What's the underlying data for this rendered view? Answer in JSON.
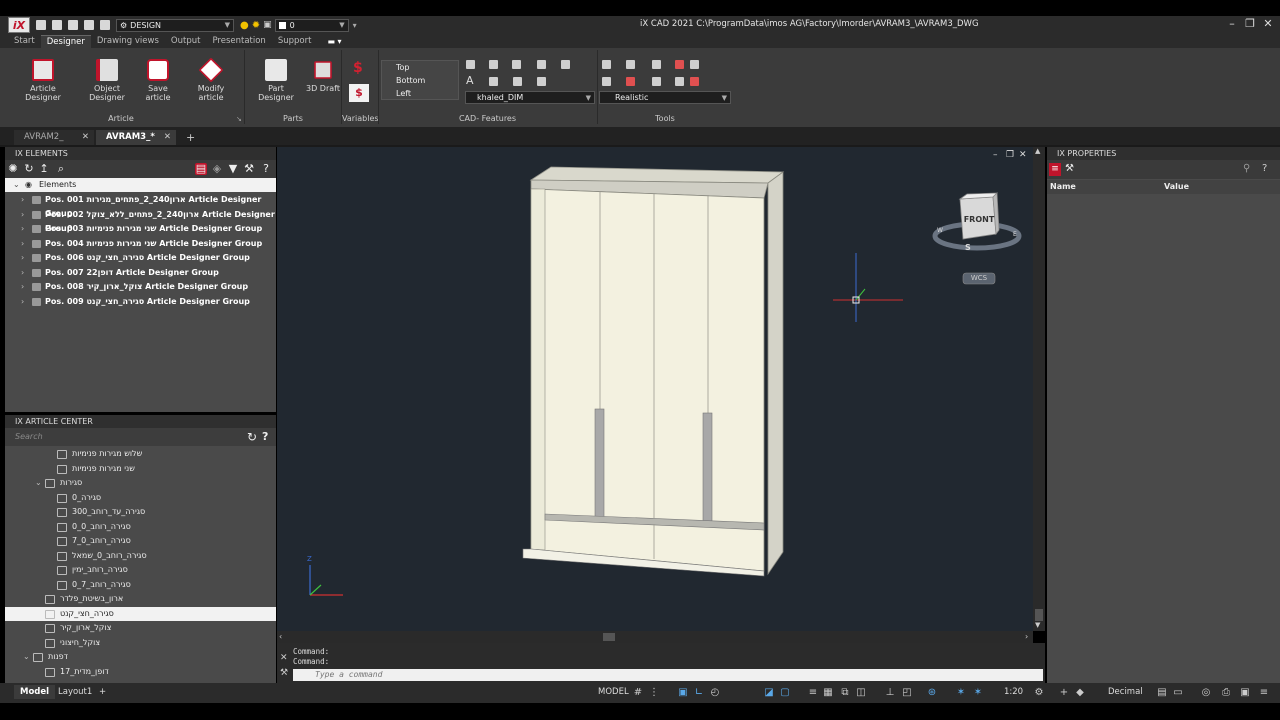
{
  "app": {
    "logo": "iX",
    "workspace": "DESIGN",
    "layer": "0",
    "title": "iX CAD 2021    C:\\ProgramData\\imos AG\\Factory\\Imorder\\AVRAM3_\\AVRAM3_DWG"
  },
  "menu": [
    "Start",
    "Designer",
    "Drawing views",
    "Output",
    "Presentation",
    "Support"
  ],
  "ribbon": {
    "article_designer": "Article Designer",
    "object_designer": "Object Designer",
    "save_article": "Save article",
    "modify_article": "Modify article",
    "group_article": "Article",
    "part_designer": "Part Designer",
    "draft_3d": "3D Draft",
    "group_parts": "Parts",
    "group_variables": "Variables",
    "views": [
      "Top",
      "Bottom",
      "Left"
    ],
    "dim_style": "khaled_DIM",
    "group_cad": "CAD- Features",
    "visual_style": "Realistic",
    "group_tools": "Tools"
  },
  "doc_tabs": [
    "AVRAM2_",
    "AVRAM3_*"
  ],
  "elements": {
    "header": "IX ELEMENTS",
    "root": "Elements",
    "items": [
      "Pos. 001 ארון240_2_פתחים_מגירות Article Designer Group",
      "Pos. 002 ארון240_2_פתחים_ללא_צוקל Article Designer Group",
      "Pos. 003 שני מגירות פנימיות Article Designer Group",
      "Pos. 004 שני מגירות פנימיות Article Designer Group",
      "Pos. 006 סגירה_חצי_קנט Article Designer Group",
      "Pos. 007 דופן22 Article Designer Group",
      "Pos. 008 צוקל_ארון_קיר Article Designer Group",
      "Pos. 009 סגירה_חצי_קנט Article Designer Group"
    ]
  },
  "article_center": {
    "header": "IX ARTICLE CENTER",
    "search_placeholder": "Search",
    "items": [
      {
        "label": "שלוש מגירות פנימיות",
        "indent": 2,
        "type": "article"
      },
      {
        "label": "שני מגירות פנימיות",
        "indent": 2,
        "type": "article"
      },
      {
        "label": "סגירות",
        "indent": 1,
        "type": "folder"
      },
      {
        "label": "סגירה_0",
        "indent": 2,
        "type": "article"
      },
      {
        "label": "סגירה_עד_רוחב_300",
        "indent": 2,
        "type": "article"
      },
      {
        "label": "סגירה_רוחב_0_0",
        "indent": 2,
        "type": "article"
      },
      {
        "label": "סגירה_רוחב_0_7",
        "indent": 2,
        "type": "article"
      },
      {
        "label": "סגירה_רוחב_0_שמאל",
        "indent": 2,
        "type": "article"
      },
      {
        "label": "סגירה_רוחב_ימין",
        "indent": 2,
        "type": "article"
      },
      {
        "label": "סגירה_רוחב_7_0",
        "indent": 2,
        "type": "article"
      },
      {
        "label": "ארון_בשיטת_פלדר",
        "indent": 1,
        "type": "article"
      },
      {
        "label": "סגירה_חצי_קנט",
        "indent": 1,
        "type": "article",
        "selected": true
      },
      {
        "label": "צוקל_ארון_קיר",
        "indent": 1,
        "type": "article"
      },
      {
        "label": "צוקל_חיצוני",
        "indent": 1,
        "type": "article"
      },
      {
        "label": "דפנות",
        "indent": 0,
        "type": "folder"
      },
      {
        "label": "דופן_מדית_17",
        "indent": 1,
        "type": "article"
      }
    ]
  },
  "viewport": {
    "viewcube_label": "FRONT",
    "wcs": "WCS",
    "compass": {
      "n": "N",
      "s": "S",
      "e": "E",
      "w": "W"
    },
    "ucs_z": "Z"
  },
  "command": {
    "history": [
      "Command:",
      "Command:"
    ],
    "placeholder": "Type a command"
  },
  "properties": {
    "header": "IX PROPERTIES",
    "col_name": "Name",
    "col_value": "Value"
  },
  "status": {
    "tabs": [
      "Model",
      "Layout1"
    ],
    "model": "MODEL",
    "scale": "1:20",
    "units": "Decimal"
  }
}
